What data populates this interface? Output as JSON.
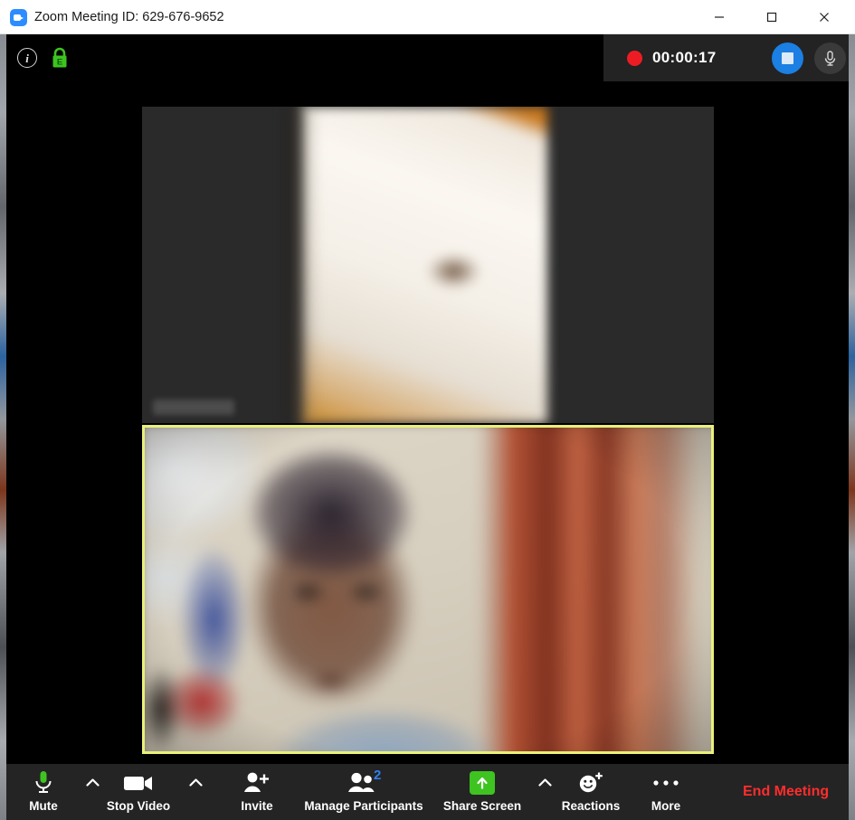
{
  "window": {
    "title": "Zoom Meeting ID: 629-676-9652",
    "app_icon": "zoom-camera-icon",
    "controls": {
      "minimize": "minimize-icon",
      "maximize": "maximize-icon",
      "close": "close-icon"
    }
  },
  "topbar": {
    "info_icon": "info-icon",
    "info_glyph": "i",
    "encryption_icon": "green-lock-icon",
    "encryption_glyph": "E",
    "recording": {
      "dot": "record-dot-icon",
      "timer": "00:00:17",
      "stop_button": "stop-recording-icon",
      "mic_button": "microphone-icon"
    }
  },
  "video": {
    "tiles": [
      {
        "name": "remote-participant-tile",
        "label": "",
        "active_speaker": false
      },
      {
        "name": "active-speaker-tile",
        "label": "",
        "active_speaker": true
      }
    ],
    "active_border_color": "#e9f07a"
  },
  "toolbar": {
    "items": [
      {
        "label": "Mute",
        "icon": "microphone-on-icon",
        "has_caret": true
      },
      {
        "label": "Stop Video",
        "icon": "video-camera-icon",
        "has_caret": true
      },
      {
        "label": "Invite",
        "icon": "add-person-icon",
        "has_caret": false
      },
      {
        "label": "Manage Participants",
        "icon": "people-icon",
        "has_caret": false,
        "badge": "2"
      },
      {
        "label": "Share Screen",
        "icon": "share-up-arrow-icon",
        "has_caret": true
      },
      {
        "label": "Reactions",
        "icon": "smiley-plus-icon",
        "has_caret": false
      },
      {
        "label": "More",
        "icon": "ellipsis-icon",
        "has_caret": false
      }
    ],
    "end_meeting": {
      "label": "End Meeting",
      "color": "#ff2d2d"
    }
  }
}
